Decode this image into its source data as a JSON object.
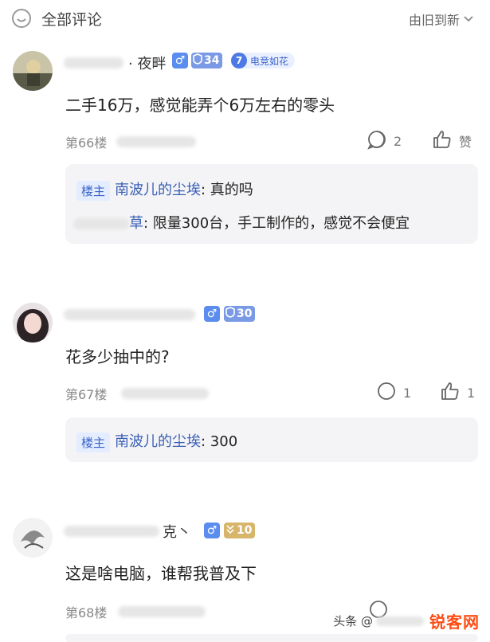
{
  "header": {
    "title": "全部评论",
    "sort_label": "由旧到新"
  },
  "comments": [
    {
      "name_visible": "· 夜畔",
      "gender": "♂",
      "level": "34",
      "badge_level": "7",
      "badge_text": "电竞如花",
      "text": "二手16万，感觉能弄个6万左右的零头",
      "floor": "第66楼",
      "reply_count": "2",
      "like_label": "赞",
      "replies": [
        {
          "owner_tag": "楼主",
          "name": "南波儿的尘埃",
          "text": ": 真的吗"
        },
        {
          "name_visible": "草",
          "text": ": 限量300台，手工制作的，感觉不会便宜"
        }
      ]
    },
    {
      "gender": "♂",
      "level": "30",
      "text": "花多少抽中的?",
      "floor": "第67楼",
      "reply_count": "1",
      "like_count": "1",
      "replies": [
        {
          "owner_tag": "楼主",
          "name": "南波儿的尘埃",
          "text": ": 300"
        }
      ]
    },
    {
      "name_visible": "克丶",
      "gender": "♂",
      "level": "10",
      "text": "这是啥电脑，谁帮我普及下",
      "floor": "第68楼"
    }
  ],
  "watermark": {
    "left": "头条 @",
    "logo": "锐客网"
  },
  "colors": {
    "link": "#3a5fb5",
    "tag_bg": "#e4ecff",
    "level_blue": "#7b9ae6",
    "level_gold": "#d7b56a"
  }
}
